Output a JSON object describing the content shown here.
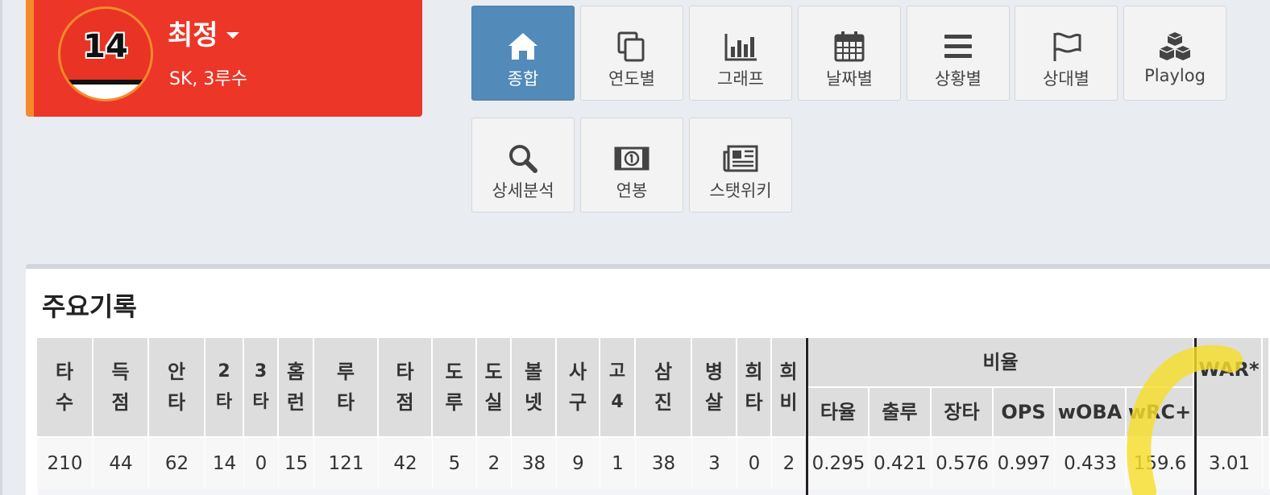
{
  "player": {
    "number": "14",
    "name": "최정",
    "team_position": "SK, 3루수"
  },
  "nav": {
    "row1": [
      {
        "label": "종합",
        "icon": "home-icon",
        "active": true
      },
      {
        "label": "연도별",
        "icon": "copy-icon"
      },
      {
        "label": "그래프",
        "icon": "bar-chart-icon"
      },
      {
        "label": "날짜별",
        "icon": "calendar-icon"
      },
      {
        "label": "상황별",
        "icon": "bars-icon"
      },
      {
        "label": "상대별",
        "icon": "flag-icon"
      },
      {
        "label": "Playlog",
        "icon": "cubes-icon"
      }
    ],
    "row2": [
      {
        "label": "상세분석",
        "icon": "search-icon"
      },
      {
        "label": "연봉",
        "icon": "money-icon"
      },
      {
        "label": "스탯위키",
        "icon": "newspaper-icon"
      }
    ]
  },
  "stats": {
    "title": "주요기록",
    "group_label": "비율",
    "headers": [
      "타\n수",
      "득\n점",
      "안\n타",
      "2\n타",
      "3\n타",
      "홈\n런",
      "루\n타",
      "타\n점",
      "도\n루",
      "도\n실",
      "볼\n넷",
      "사\n구",
      "고\n4",
      "삼\n진",
      "병\n살",
      "희\n타",
      "희\n비"
    ],
    "ratio_headers": [
      "타율",
      "출루",
      "장타",
      "OPS",
      "wOBA",
      "wRC+"
    ],
    "war_header": "WAR*",
    "values": [
      "210",
      "44",
      "62",
      "14",
      "0",
      "15",
      "121",
      "42",
      "5",
      "2",
      "38",
      "9",
      "1",
      "38",
      "3",
      "0",
      "2"
    ],
    "ratio_values": [
      "0.295",
      "0.421",
      "0.576",
      "0.997",
      "0.433",
      "159.6"
    ],
    "war_value": "3.01"
  },
  "colors": {
    "card_red": "#ec3628",
    "card_accent": "#f58a2a",
    "active_tile": "#528ab9",
    "highlight": "#f7de2a"
  }
}
